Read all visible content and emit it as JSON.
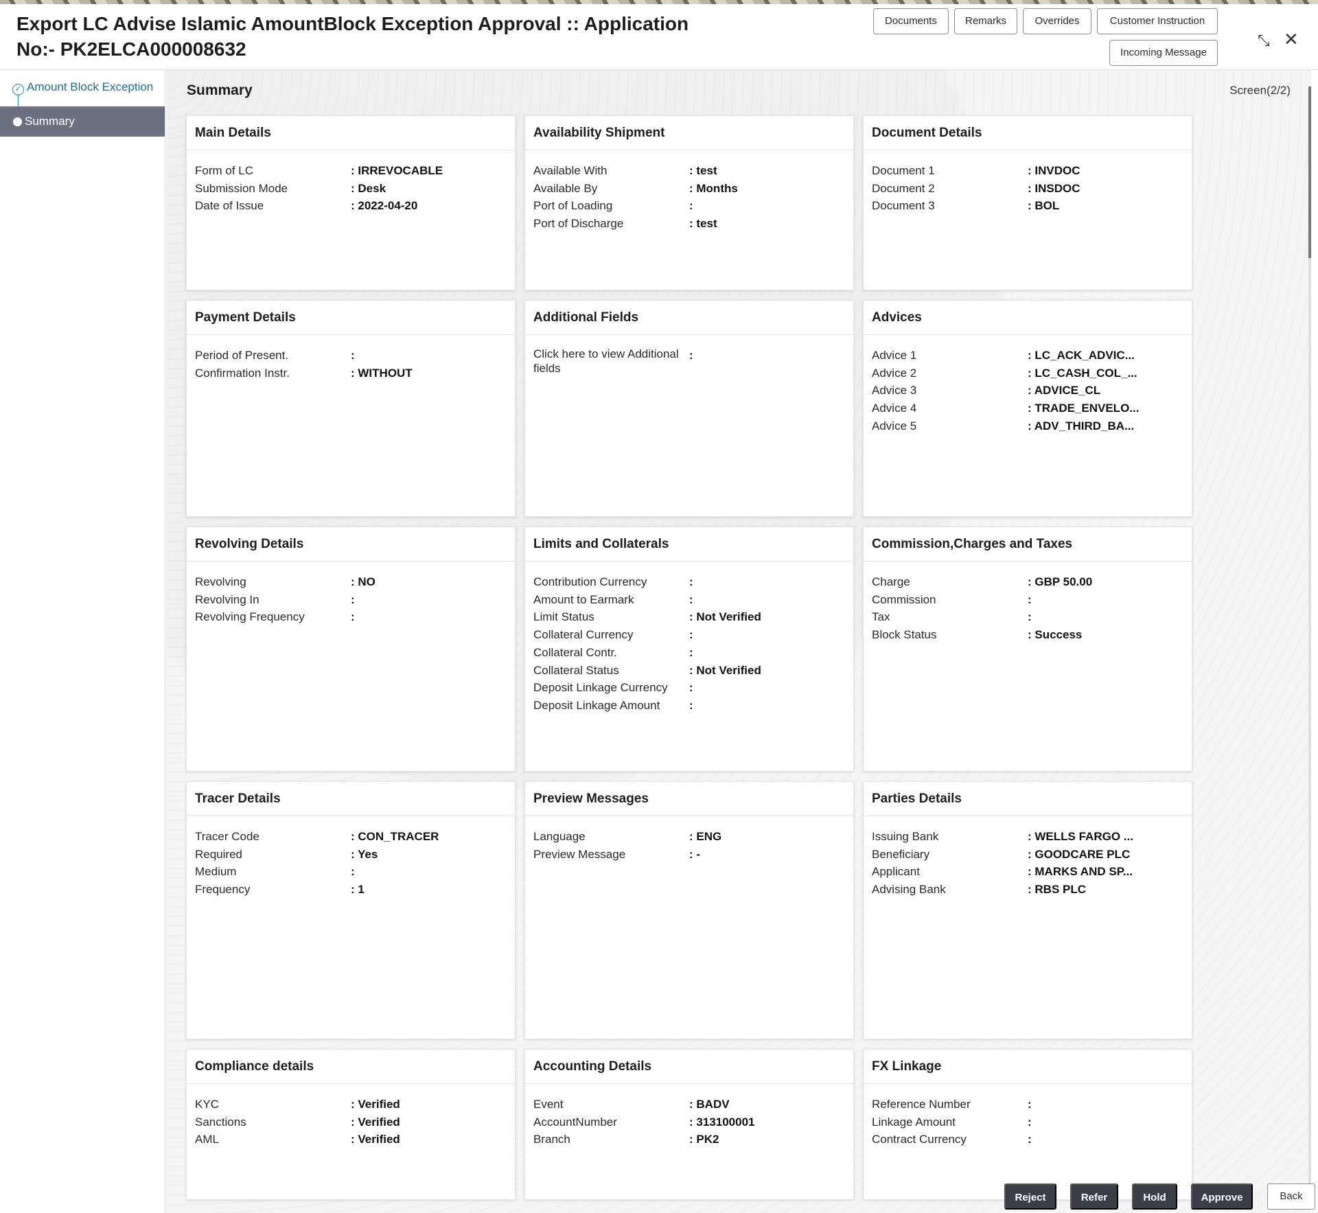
{
  "header": {
    "title": "Export LC Advise Islamic AmountBlock Exception Approval :: Application No:- PK2ELCA000008632",
    "buttons": {
      "documents": "Documents",
      "remarks": "Remarks",
      "overrides": "Overrides",
      "customer_instruction": "Customer Instruction",
      "incoming_message": "Incoming Message"
    },
    "icons": {
      "minimize": "compress-icon",
      "close": "close-icon"
    }
  },
  "sidebar": {
    "steps": [
      {
        "label": "Amount Block Exception",
        "state": "completed"
      },
      {
        "label": "Summary",
        "state": "active"
      }
    ]
  },
  "main": {
    "title": "Summary",
    "screen_indicator": "Screen(2/2)"
  },
  "cards": {
    "main_details": {
      "title": "Main Details",
      "rows": [
        {
          "k": "Form of LC",
          "v": ": IRREVOCABLE"
        },
        {
          "k": "Submission Mode",
          "v": ": Desk"
        },
        {
          "k": "Date of Issue",
          "v": ": 2022-04-20"
        }
      ]
    },
    "availability_shipment": {
      "title": "Availability Shipment",
      "rows": [
        {
          "k": "Available With",
          "v": ": test"
        },
        {
          "k": "Available By",
          "v": ": Months"
        },
        {
          "k": "Port of Loading",
          "v": ":"
        },
        {
          "k": "Port of Discharge",
          "v": ": test"
        }
      ]
    },
    "document_details": {
      "title": "Document Details",
      "rows": [
        {
          "k": "Document 1",
          "v": ": INVDOC"
        },
        {
          "k": "Document 2",
          "v": ": INSDOC"
        },
        {
          "k": "Document 3",
          "v": ": BOL"
        }
      ]
    },
    "payment_details": {
      "title": "Payment Details",
      "rows": [
        {
          "k": "Period of Present.",
          "v": ":"
        },
        {
          "k": "Confirmation Instr.",
          "v": ": WITHOUT"
        }
      ]
    },
    "additional_fields": {
      "title": "Additional Fields",
      "rows": [
        {
          "k": "Click here to view Additional fields",
          "v": ":"
        }
      ]
    },
    "advices": {
      "title": "Advices",
      "rows": [
        {
          "k": "Advice 1",
          "v": ": LC_ACK_ADVIC..."
        },
        {
          "k": "Advice 2",
          "v": ": LC_CASH_COL_..."
        },
        {
          "k": "Advice 3",
          "v": ": ADVICE_CL"
        },
        {
          "k": "Advice 4",
          "v": ": TRADE_ENVELO..."
        },
        {
          "k": "Advice 5",
          "v": ": ADV_THIRD_BA..."
        }
      ]
    },
    "revolving_details": {
      "title": "Revolving Details",
      "rows": [
        {
          "k": "Revolving",
          "v": ": NO"
        },
        {
          "k": "Revolving In",
          "v": ":"
        },
        {
          "k": "Revolving Frequency",
          "v": ":"
        }
      ]
    },
    "limits_collaterals": {
      "title": "Limits and Collaterals",
      "rows": [
        {
          "k": "Contribution Currency",
          "v": ":"
        },
        {
          "k": "Amount to Earmark",
          "v": ":"
        },
        {
          "k": "Limit Status",
          "v": ": Not Verified"
        },
        {
          "k": "Collateral Currency",
          "v": ":"
        },
        {
          "k": "Collateral Contr.",
          "v": ":"
        },
        {
          "k": "Collateral Status",
          "v": ": Not Verified"
        },
        {
          "k": "Deposit Linkage Currency",
          "v": ":"
        },
        {
          "k": "Deposit Linkage Amount",
          "v": ":"
        }
      ]
    },
    "commission_charges_taxes": {
      "title": "Commission,Charges and Taxes",
      "rows": [
        {
          "k": "Charge",
          "v": ": GBP  50.00"
        },
        {
          "k": "Commission",
          "v": ":"
        },
        {
          "k": "Tax",
          "v": ":"
        },
        {
          "k": "Block Status",
          "v": ": Success"
        }
      ]
    },
    "tracer_details": {
      "title": "Tracer Details",
      "rows": [
        {
          "k": "Tracer Code",
          "v": ": CON_TRACER"
        },
        {
          "k": "Required",
          "v": ": Yes"
        },
        {
          "k": "Medium",
          "v": ":"
        },
        {
          "k": "Frequency",
          "v": ": 1"
        }
      ]
    },
    "preview_messages": {
      "title": "Preview Messages",
      "rows": [
        {
          "k": "Language",
          "v": ": ENG"
        },
        {
          "k": "Preview Message",
          "v": ": -"
        }
      ]
    },
    "parties_details": {
      "title": "Parties Details",
      "rows": [
        {
          "k": "Issuing Bank",
          "v": ": WELLS FARGO ..."
        },
        {
          "k": "Beneficiary",
          "v": ": GOODCARE PLC"
        },
        {
          "k": "Applicant",
          "v": ": MARKS AND SP..."
        },
        {
          "k": "Advising Bank",
          "v": ": RBS PLC"
        }
      ]
    },
    "compliance_details": {
      "title": "Compliance details",
      "rows": [
        {
          "k": "KYC",
          "v": ": Verified"
        },
        {
          "k": "Sanctions",
          "v": ": Verified"
        },
        {
          "k": "AML",
          "v": ": Verified"
        }
      ]
    },
    "accounting_details": {
      "title": "Accounting Details",
      "rows": [
        {
          "k": "Event",
          "v": ": BADV"
        },
        {
          "k": "AccountNumber",
          "v": ": 313100001"
        },
        {
          "k": "Branch",
          "v": ": PK2"
        }
      ]
    },
    "fx_linkage": {
      "title": "FX Linkage",
      "rows": [
        {
          "k": "Reference Number",
          "v": ":"
        },
        {
          "k": "Linkage Amount",
          "v": ":"
        },
        {
          "k": "Contract Currency",
          "v": ":"
        }
      ]
    }
  },
  "footer": {
    "reject": "Reject",
    "refer": "Refer",
    "hold": "Hold",
    "approve": "Approve",
    "back": "Back"
  }
}
